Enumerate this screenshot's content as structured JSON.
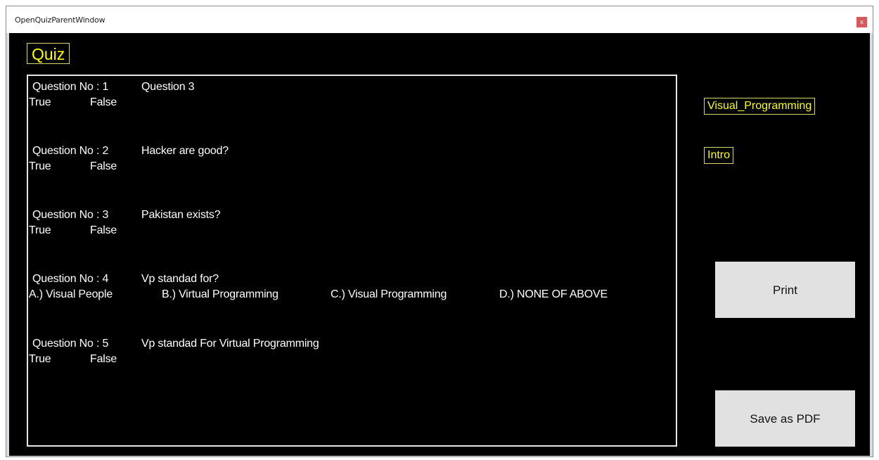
{
  "window": {
    "title": "OpenQuizParentWindow",
    "close_glyph": "x"
  },
  "header": {
    "title": "Quiz"
  },
  "side": {
    "subject": "Visual_Programming",
    "topic": "Intro"
  },
  "buttons": {
    "print": "Print",
    "save_pdf": "Save as PDF"
  },
  "questions": [
    {
      "label": "Question No : 1",
      "text": "Question 3",
      "options": [
        "True",
        "False"
      ]
    },
    {
      "label": "Question No : 2",
      "text": "Hacker are good?",
      "options": [
        "True",
        "False"
      ]
    },
    {
      "label": "Question No : 3",
      "text": "Pakistan exists?",
      "options": [
        "True",
        "False"
      ]
    },
    {
      "label": "Question No : 4",
      "text": "Vp standad for?",
      "options": [
        "A.) Visual People",
        "B.) Virtual Programming",
        "C.) Visual Programming",
        "D.) NONE OF ABOVE"
      ]
    },
    {
      "label": "Question No : 5",
      "text": "Vp standad For Virtual Programming",
      "options": [
        "True",
        "False"
      ]
    }
  ]
}
